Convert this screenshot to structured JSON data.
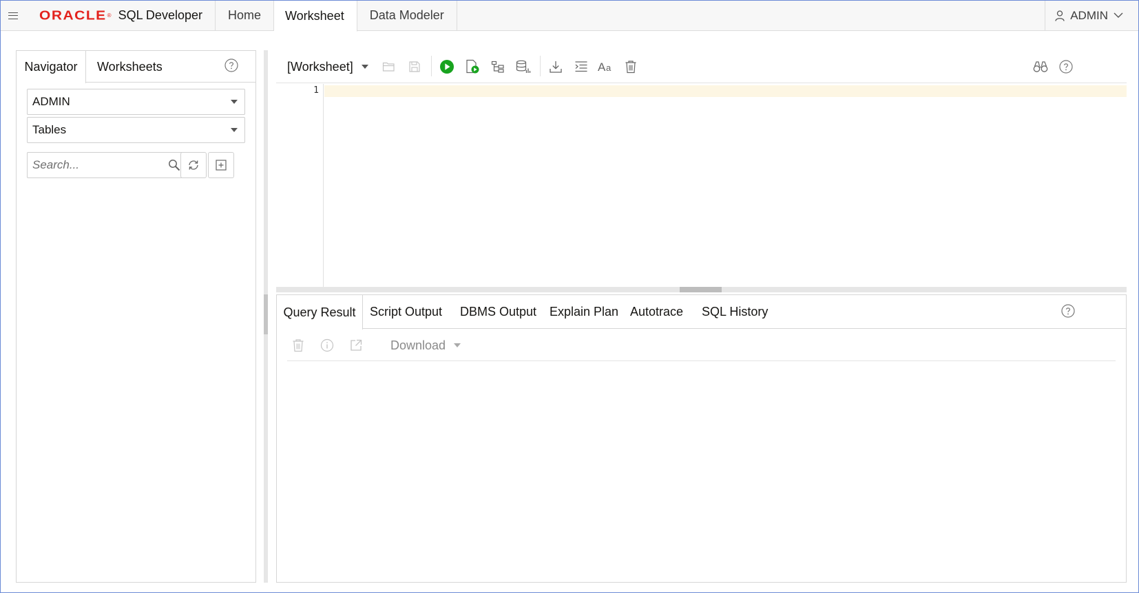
{
  "app": {
    "brand": "ORACLE",
    "product": "SQL Developer"
  },
  "top_tabs": [
    {
      "label": "Home",
      "active": false
    },
    {
      "label": "Worksheet",
      "active": true
    },
    {
      "label": "Data Modeler",
      "active": false
    }
  ],
  "user": {
    "name": "ADMIN"
  },
  "navigator": {
    "tabs": [
      {
        "label": "Navigator",
        "active": true
      },
      {
        "label": "Worksheets",
        "active": false
      }
    ],
    "schema_select": "ADMIN",
    "object_type_select": "Tables",
    "search_placeholder": "Search..."
  },
  "worksheet": {
    "selector": "[Worksheet]",
    "line_numbers": [
      "1"
    ],
    "toolbar_icons": [
      "open-folder-icon",
      "save-icon",
      "run-statement-icon",
      "run-script-icon",
      "explain-plan-icon",
      "autotrace-icon",
      "download-icon",
      "format-icon",
      "case-icon",
      "clear-icon",
      "find-icon",
      "help-icon"
    ],
    "run_color": "#18a31f"
  },
  "results": {
    "tabs": [
      {
        "label": "Query Result",
        "active": true
      },
      {
        "label": "Script Output",
        "active": false
      },
      {
        "label": "DBMS Output",
        "active": false
      },
      {
        "label": "Explain Plan",
        "active": false
      },
      {
        "label": "Autotrace",
        "active": false
      },
      {
        "label": "SQL History",
        "active": false
      }
    ],
    "download_label": "Download"
  },
  "colors": {
    "brand_red": "#e3221d",
    "frame_border": "#6b8ad6",
    "active_line": "#fdf6e3"
  }
}
